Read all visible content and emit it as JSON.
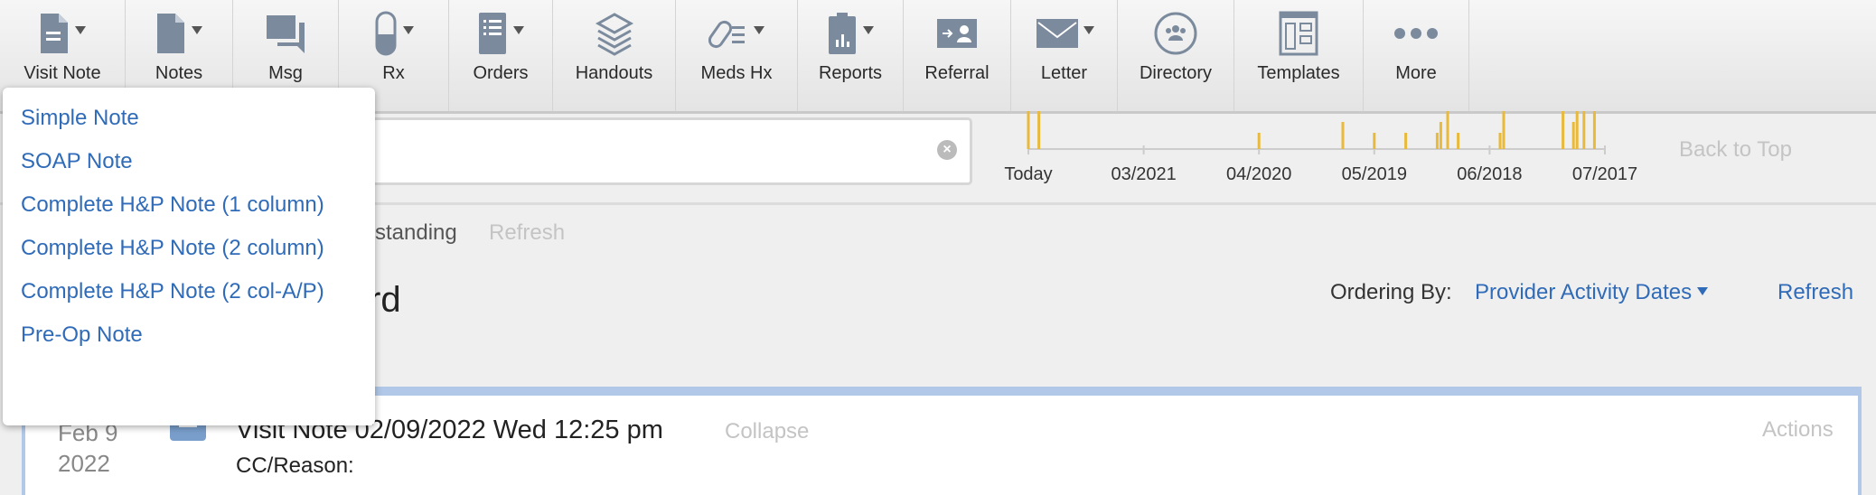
{
  "toolbar": {
    "items": [
      {
        "label": "Visit Note",
        "icon": "visit-note-icon",
        "caret": true
      },
      {
        "label": "Notes",
        "icon": "notes-icon",
        "caret": true
      },
      {
        "label": "Msg",
        "icon": "message-icon",
        "caret": false
      },
      {
        "label": "Rx",
        "icon": "pill-icon",
        "caret": true
      },
      {
        "label": "Orders",
        "icon": "orders-list-icon",
        "caret": true
      },
      {
        "label": "Handouts",
        "icon": "handouts-stack-icon",
        "caret": false
      },
      {
        "label": "Meds Hx",
        "icon": "meds-history-icon",
        "caret": true
      },
      {
        "label": "Reports",
        "icon": "reports-clipboard-icon",
        "caret": true
      },
      {
        "label": "Referral",
        "icon": "referral-icon",
        "caret": false
      },
      {
        "label": "Letter",
        "icon": "envelope-icon",
        "caret": true
      },
      {
        "label": "Directory",
        "icon": "directory-people-icon",
        "caret": false
      },
      {
        "label": "Templates",
        "icon": "templates-icon",
        "caret": false
      },
      {
        "label": "More",
        "icon": "more-dots-icon",
        "caret": false
      }
    ]
  },
  "dropdown": {
    "items": [
      "Simple Note",
      "SOAP Note",
      "Complete H&P Note (1 column)",
      "Complete H&P Note (2 column)",
      "Complete H&P Note (2 col-A/P)",
      "Pre-Op Note"
    ]
  },
  "timeline": {
    "tick_labels": [
      "Today",
      "03/2021",
      "04/2020",
      "05/2019",
      "06/2018",
      "07/2017"
    ],
    "bar_color": "#e8b93a",
    "bars": [
      {
        "date": "2022-02",
        "level": 3
      },
      {
        "date": "2022-01",
        "level": 3
      },
      {
        "date": "2020-04",
        "level": 1
      },
      {
        "date": "2019-08",
        "level": 2
      },
      {
        "date": "2019-05",
        "level": 1
      },
      {
        "date": "2019-02",
        "level": 1
      },
      {
        "date": "2018-11",
        "level": 1
      },
      {
        "date": "2018-11",
        "level": 2
      },
      {
        "date": "2018-10",
        "level": 3
      },
      {
        "date": "2018-09",
        "level": 1
      },
      {
        "date": "2018-05",
        "level": 1
      },
      {
        "date": "2018-05",
        "level": 3
      },
      {
        "date": "2017-11",
        "level": 3
      },
      {
        "date": "2017-10",
        "level": 2
      },
      {
        "date": "2017-10",
        "level": 3
      },
      {
        "date": "2017-09",
        "level": 3
      },
      {
        "date": "2017-08",
        "level": 3
      }
    ]
  },
  "nav": {
    "back_to_top": "Back to Top"
  },
  "filters": {
    "partial_label": "standing",
    "refresh": "Refresh"
  },
  "header": {
    "partial_title": "rd",
    "ordering_label": "Ordering By:",
    "ordering_value": "Provider Activity Dates",
    "refresh": "Refresh"
  },
  "entry": {
    "month_day": "Feb 9",
    "year": "2022",
    "title": "Visit Note 02/09/2022 Wed 12:25 pm",
    "collapse": "Collapse",
    "actions": "Actions",
    "cc_label": "CC/Reason:"
  },
  "colors": {
    "link": "#2f6bb8",
    "accent_border": "#b1c8e8",
    "icon": "#7b8b9d"
  }
}
